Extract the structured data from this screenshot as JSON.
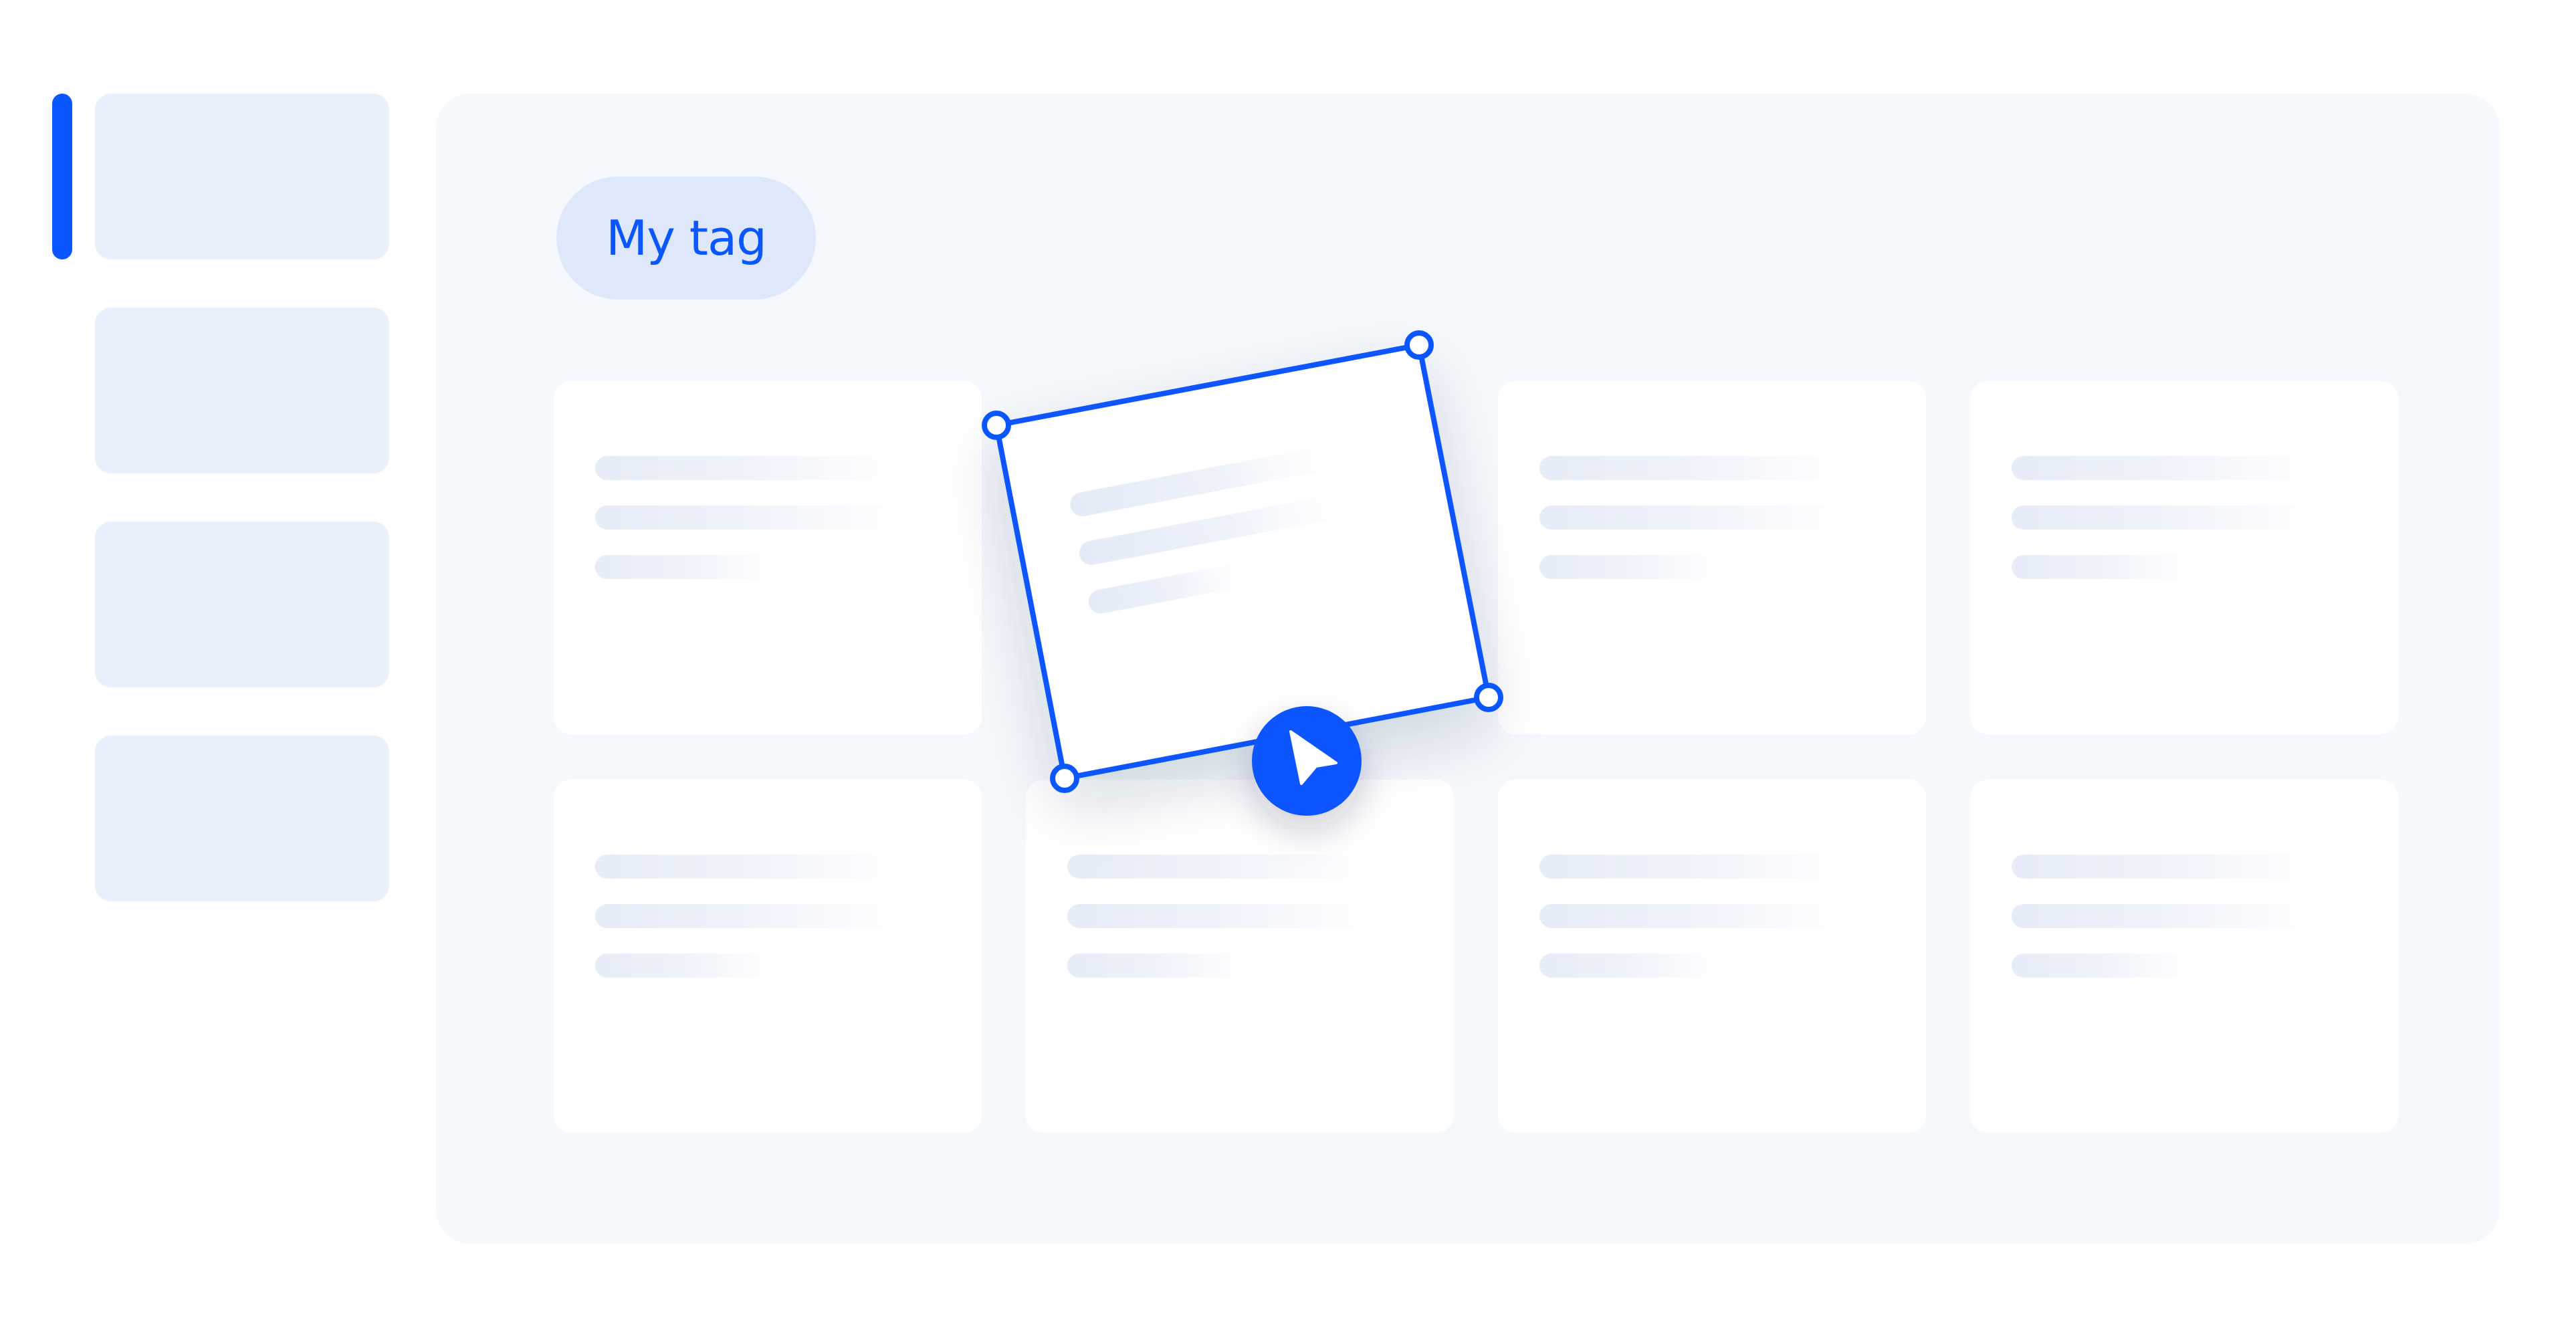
{
  "tag": {
    "label": "My tag"
  },
  "sidebar": {
    "items": [
      {
        "name": "sidebar-item-1"
      },
      {
        "name": "sidebar-item-2"
      },
      {
        "name": "sidebar-item-3"
      },
      {
        "name": "sidebar-item-4"
      }
    ]
  },
  "board": {
    "cards": [
      {
        "row": 1,
        "col": 1
      },
      {
        "row": 1,
        "col": 3
      },
      {
        "row": 1,
        "col": 4
      },
      {
        "row": 2,
        "col": 1
      },
      {
        "row": 2,
        "col": 2
      },
      {
        "row": 2,
        "col": 3
      },
      {
        "row": 2,
        "col": 4
      }
    ]
  },
  "dragged_card": {
    "handles": 4
  },
  "cursor": {
    "icon": "pointer-arrow-icon"
  },
  "colors": {
    "accent": "#0b57ff",
    "chip_bg": "#dfe8fb",
    "panel_bg": "#f5f8fd",
    "sidebar_item_bg": "#e9effb",
    "card_bg": "#ffffff"
  }
}
